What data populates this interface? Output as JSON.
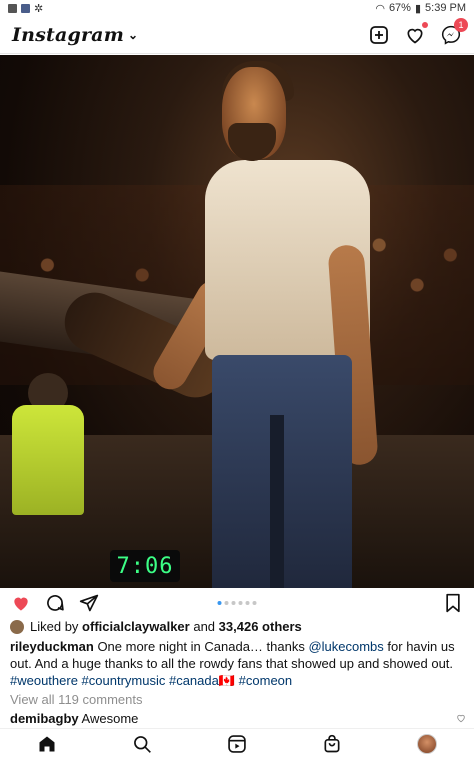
{
  "status_bar": {
    "battery": "67%",
    "time": "5:39 PM"
  },
  "header": {
    "logo_text": "Instagram",
    "messages_badge": "1"
  },
  "post": {
    "photo_alt_clock": "7:06",
    "carousel": {
      "count": 6,
      "active_index": 0
    },
    "likes": {
      "prefix": "Liked by",
      "user": "officialclaywalker",
      "conjunction": "and",
      "others": "33,426 others"
    },
    "caption": {
      "username": "rileyduckman",
      "text_1": " One more night in Canada… thanks ",
      "mention": "@lukecombs",
      "text_2": " for havin us out. And a huge thanks to all the rowdy fans that showed up and showed out.",
      "hashtags_1": "#weouthere #countrymusic #canada",
      "flag": "🇨🇦",
      "hashtags_2": " #comeon"
    },
    "view_comments": "View all 119 comments",
    "top_comment": {
      "username": "demibagby",
      "text": "Awesome"
    }
  },
  "colors": {
    "accent_like": "#ed4956",
    "link": "#00376b",
    "muted": "#8e8e8e",
    "dot_active": "#3897f0"
  }
}
